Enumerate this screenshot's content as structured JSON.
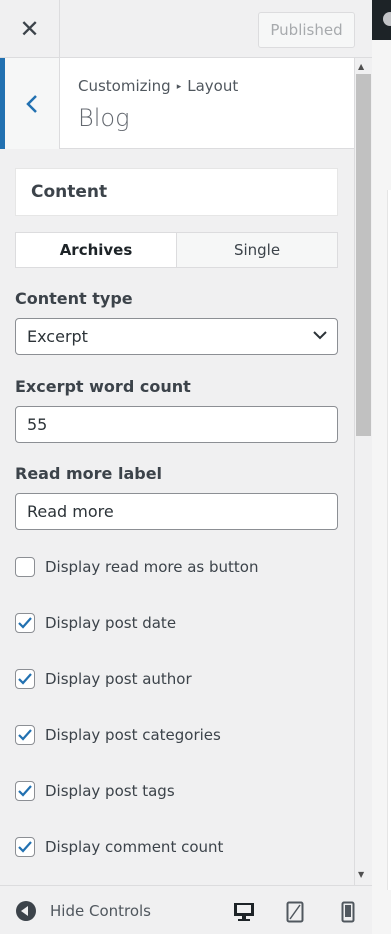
{
  "header": {
    "close_label": "✕",
    "publish_label": "Published"
  },
  "section": {
    "breadcrumb_parent": "Customizing",
    "breadcrumb_separator": "▸",
    "breadcrumb_child": "Layout",
    "title": "Blog"
  },
  "panel": {
    "group_title": "Content",
    "tabs": [
      {
        "label": "Archives",
        "active": true
      },
      {
        "label": "Single",
        "active": false
      }
    ],
    "content_type": {
      "label": "Content type",
      "value": "Excerpt"
    },
    "excerpt_word_count": {
      "label": "Excerpt word count",
      "value": "55"
    },
    "read_more": {
      "label": "Read more label",
      "value": "Read more"
    },
    "checkboxes": [
      {
        "label": "Display read more as button",
        "checked": false
      },
      {
        "label": "Display post date",
        "checked": true
      },
      {
        "label": "Display post author",
        "checked": true
      },
      {
        "label": "Display post categories",
        "checked": true
      },
      {
        "label": "Display post tags",
        "checked": true
      },
      {
        "label": "Display comment count",
        "checked": true
      }
    ]
  },
  "footer": {
    "hide_controls_label": "Hide Controls",
    "devices": [
      "desktop-icon",
      "tablet-icon",
      "mobile-icon"
    ],
    "active_device": "desktop"
  },
  "colors": {
    "accent": "#2271b1",
    "sidebar_bg": "#f0f0f1"
  }
}
